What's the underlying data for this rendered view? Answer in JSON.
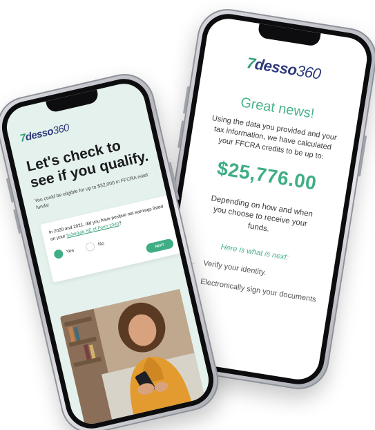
{
  "front_phone": {
    "logo": {
      "mark": "7",
      "word": "desso",
      "num": "360"
    },
    "heading": "Let's check to see if you qualify.",
    "subtext": "You could be eligible for up to $32,000 in FFCRA relief funds!",
    "question": {
      "text": "In 2020 and 2021, did you have positive net earnings listed on your",
      "link_text": "Schedule SE of Form 1040",
      "suffix": "?",
      "options": [
        {
          "label": "Yes",
          "selected": true
        },
        {
          "label": "No",
          "selected": false
        }
      ],
      "next_label": "NEXT"
    }
  },
  "back_phone": {
    "logo": {
      "mark": "7",
      "word": "desso",
      "num": "360"
    },
    "headline": "Great news!",
    "explanation": "Using the data you provided and your tax information, we have calculated your FFCRA credits to be up to:",
    "amount": "$25,776.00",
    "depending": "Depending on how and when you choose to receive your funds.",
    "next_title": "Here is what is next:",
    "steps": [
      {
        "num": "1.",
        "text": "Verify your identity."
      },
      {
        "num": "2.",
        "text": "Electronically sign your documents"
      }
    ]
  },
  "colors": {
    "brand_green": "#3fae84",
    "brand_navy": "#2f3a7a",
    "front_screen_bg": "#e4f1ec"
  }
}
